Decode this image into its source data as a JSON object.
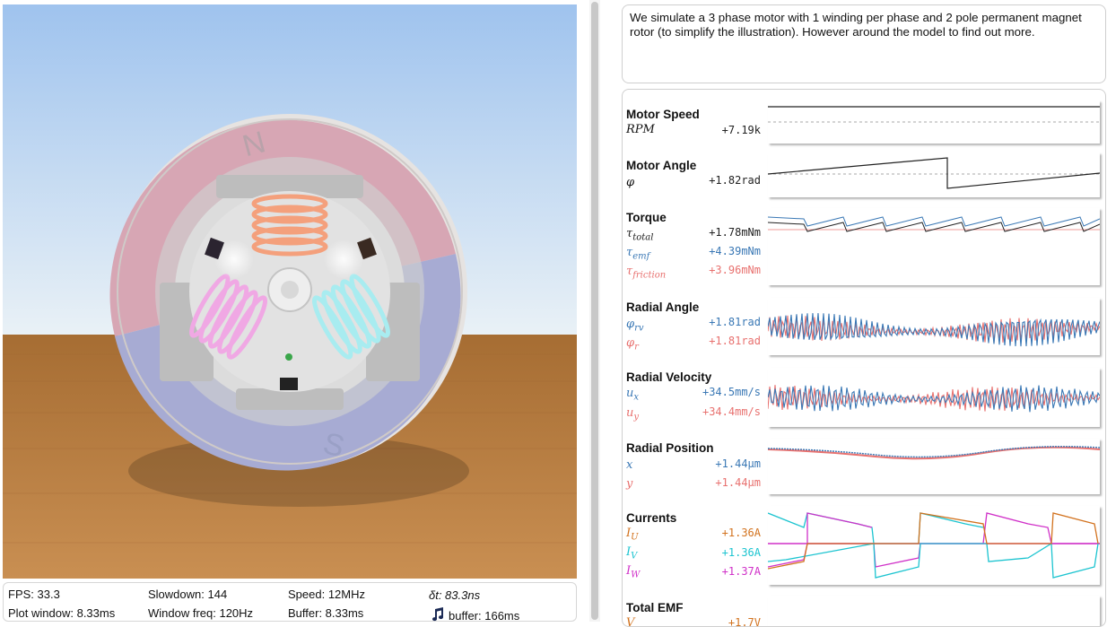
{
  "viewport": {
    "magnet_north": "N",
    "magnet_south": "S",
    "colors": {
      "sky_top": "#a9c8f0",
      "sky_bottom": "#e8f0f6",
      "floor": "#b57a3c",
      "north_pole": "#d9a8b5",
      "south_pole": "#a9aed6",
      "coil_u": "#f2a07c",
      "coil_v": "#f0a8e4",
      "coil_w": "#a8ecf0"
    }
  },
  "stats": {
    "fps": "FPS: 33.3",
    "plot_window": "Plot window: 8.33ms",
    "slowdown": "Slowdown: 144",
    "window_freq": "Window freq: 120Hz",
    "speed": "Speed: 12MHz",
    "buffer": "Buffer: 8.33ms",
    "dt": "δt: 83.3ns",
    "audio_buffer": "buffer: 166ms"
  },
  "description": "We simulate a 3 phase motor with 1 winding per phase and 2 pole permanent magnet rotor (to simplify the illustration). However around the model to find out more.",
  "plots": {
    "motor_speed": {
      "title": "Motor Speed",
      "sym": "RPM",
      "value": "+7.19k"
    },
    "motor_angle": {
      "title": "Motor Angle",
      "sym": "φ",
      "value": "+1.82rad"
    },
    "torque": {
      "title": "Torque",
      "total": {
        "sym": "τ",
        "sub": "total",
        "value": "+1.78mNm"
      },
      "emf": {
        "sym": "τ",
        "sub": "emf",
        "value": "+4.39mNm"
      },
      "friction": {
        "sym": "τ",
        "sub": "friction",
        "value": "+3.96mNm"
      }
    },
    "radial_angle": {
      "title": "Radial Angle",
      "rv": {
        "sym": "φ",
        "sub": "rv",
        "value": "+1.81rad"
      },
      "r": {
        "sym": "φ",
        "sub": "r",
        "value": "+1.81rad"
      }
    },
    "radial_velocity": {
      "title": "Radial Velocity",
      "ux": {
        "sym": "u",
        "sub": "x",
        "value": "+34.5mm/s"
      },
      "uy": {
        "sym": "u",
        "sub": "y",
        "value": "+34.4mm/s"
      }
    },
    "radial_position": {
      "title": "Radial Position",
      "x": {
        "sym": "x",
        "value": "+1.44μm"
      },
      "y": {
        "sym": "y",
        "value": "+1.44μm"
      }
    },
    "currents": {
      "title": "Currents",
      "iu": {
        "sym": "I",
        "sub": "U",
        "value": "+1.36A"
      },
      "iv": {
        "sym": "I",
        "sub": "V",
        "value": "+1.36A"
      },
      "iw": {
        "sym": "I",
        "sub": "W",
        "value": "+1.37A"
      }
    },
    "total_emf": {
      "title": "Total EMF",
      "sym": "V",
      "value": "+1.7V"
    }
  },
  "colors": {
    "black_series": "#222222",
    "blue_series": "#3a78b5",
    "red_series": "#e8716f",
    "orange_series": "#d2721e",
    "cyan_series": "#1cc4d0",
    "magenta_series": "#d030c8"
  }
}
